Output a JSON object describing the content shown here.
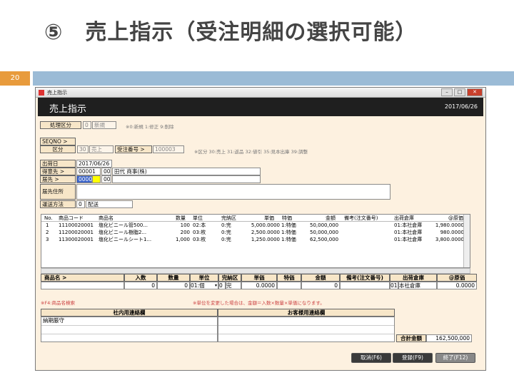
{
  "slide": {
    "title": "⑤　売上指示（受注明細の選択可能）",
    "number": "20"
  },
  "window": {
    "title": "売上指示",
    "controls": [
      "–",
      "□",
      "✕"
    ]
  },
  "header": {
    "title": "売上指示",
    "date": "2017/06/26"
  },
  "form": {
    "shori_label": "処理区分",
    "shori_code": "0",
    "shori_name": "新規",
    "shori_note": "※0:新規 1:修正 9:削除",
    "seqno_label": "SEQNO >",
    "kubun_label": "区分",
    "kubun_code": "30",
    "kubun_name": "売上",
    "juchu_label": "受注番号 >",
    "juchu_value": "100003",
    "kubun_note": "※区分 30:売上 31:返品 32:値引 35:見本出庫 39:調整",
    "shukka_label": "出荷日",
    "shukka_value": "2017/06/26",
    "tokui_label": "得意先 >",
    "tokui_code": "00001",
    "tokui_sub": "00",
    "tokui_name": "田代 商事(株)",
    "todoke_label": "届先 >",
    "todoke_code": "00001",
    "todoke_sub": "00",
    "jusho_label": "届先住所",
    "unso_label": "運送方法",
    "unso_code": "0",
    "unso_name": "配送"
  },
  "grid": {
    "headers": [
      "No.",
      "商品コード",
      "商品名",
      "数量",
      "単位",
      "完納区",
      "単価",
      "特価",
      "金額",
      "備考(注文番号)",
      "出荷倉庫",
      "@原価"
    ],
    "rows": [
      [
        "1",
        "11100020001",
        "塩化ビニール管500...",
        "100",
        "02:本",
        "0:完",
        "5,000.0000",
        "1:特価",
        "50,000,000",
        "",
        "01:本社倉庫",
        "1,980.0000"
      ],
      [
        "2",
        "11200020001",
        "塩化ビニール樹脂2...",
        "200",
        "03:枚",
        "0:完",
        "2,500.0000",
        "1:特価",
        "50,000,000",
        "",
        "01:本社倉庫",
        "980.0000"
      ],
      [
        "3",
        "11300020001",
        "塩化ビニールシート1...",
        "1,000",
        "03:枚",
        "0:完",
        "1,250.0000",
        "1:特価",
        "62,500,000",
        "",
        "01:本社倉庫",
        "3,800.0000"
      ]
    ]
  },
  "input": {
    "headers": [
      "商品名 >",
      "入数",
      "数量",
      "単位",
      "完納区",
      "単価",
      "特価",
      "金額",
      "備考(注文番号)",
      "出荷倉庫",
      "@原価"
    ],
    "irisu": "0",
    "suryo": "0",
    "tani": "01:個",
    "kanno": "0",
    "kanno_name": "完",
    "tanka": "0.0000",
    "kingaku": "0",
    "soko_code": "01",
    "soko_name": "本社倉庫",
    "genka": "0.0000"
  },
  "notes": {
    "f4": "※F4:商品名検索",
    "tani": "※単位を変更した場合は、金額＝入数×数量×単価になります。"
  },
  "memo": {
    "internal_label": "社内用連絡欄",
    "customer_label": "お客様用連絡欄",
    "internal_line1": "納期厳守"
  },
  "total": {
    "label": "合計金額",
    "value": "162,500,000"
  },
  "buttons": {
    "cancel": "取消(F6)",
    "register": "登録(F9)",
    "close": "終了(F12)"
  }
}
